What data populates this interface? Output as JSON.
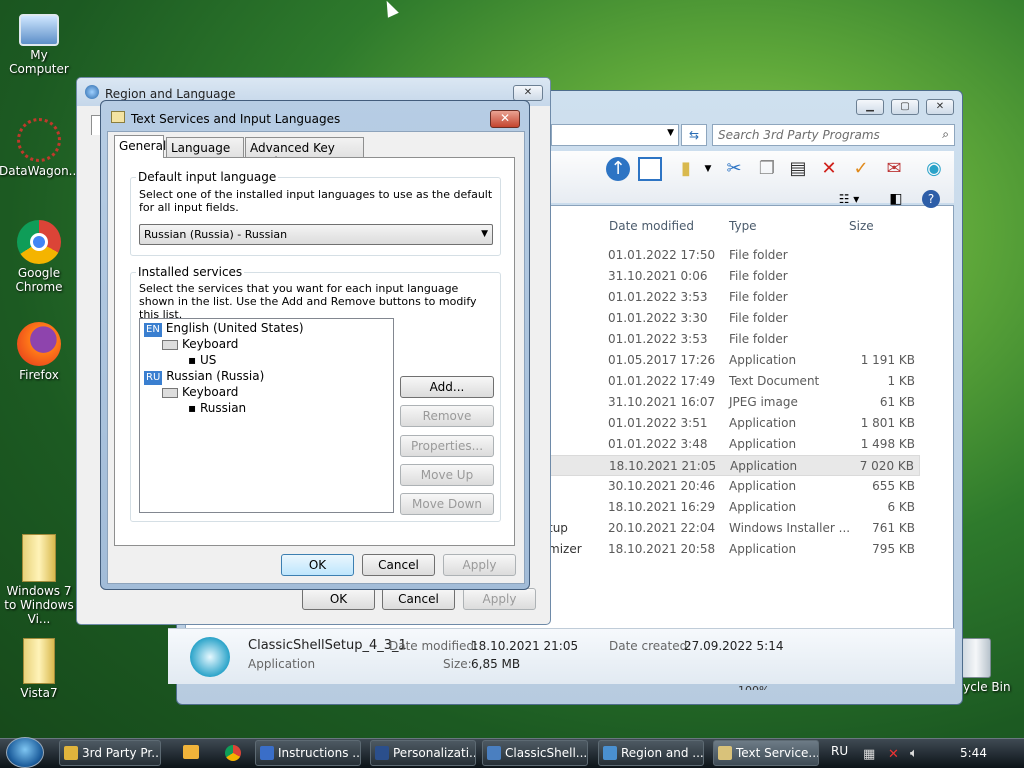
{
  "desktop": {
    "icons": [
      {
        "label": "My Computer"
      },
      {
        "label": "DataWagon..."
      },
      {
        "label": "Google Chrome"
      },
      {
        "label": "Firefox"
      },
      {
        "label": "Windows 7 to Windows Vi..."
      },
      {
        "label": "Vista7"
      },
      {
        "label": "Recycle Bin"
      }
    ]
  },
  "explorer": {
    "search_placeholder": "Search 3rd Party Programs",
    "columns": {
      "date": "Date modified",
      "type": "Type",
      "size": "Size"
    },
    "rows": [
      {
        "name": "",
        "date": "01.01.2022 17:50",
        "type": "File folder",
        "size": ""
      },
      {
        "name": "",
        "date": "31.10.2021 0:06",
        "type": "File folder",
        "size": ""
      },
      {
        "name": "",
        "date": "01.01.2022 3:53",
        "type": "File folder",
        "size": ""
      },
      {
        "name": "",
        "date": "01.01.2022 3:30",
        "type": "File folder",
        "size": ""
      },
      {
        "name": "",
        "date": "01.01.2022 3:53",
        "type": "File folder",
        "size": ""
      },
      {
        "name": "",
        "date": "01.05.2017 17:26",
        "type": "Application",
        "size": "1 191 KB"
      },
      {
        "name": "",
        "date": "01.01.2022 17:49",
        "type": "Text Document",
        "size": "1 KB"
      },
      {
        "name": "",
        "date": "31.10.2021 16:07",
        "type": "JPEG image",
        "size": "61 KB"
      },
      {
        "name": "",
        "date": "01.01.2022 3:51",
        "type": "Application",
        "size": "1 801 KB"
      },
      {
        "name": "",
        "date": "01.01.2022 3:48",
        "type": "Application",
        "size": "1 498 KB"
      },
      {
        "name": "",
        "date": "18.10.2021 21:05",
        "type": "Application",
        "size": "7 020 KB"
      },
      {
        "name": "",
        "date": "30.10.2021 20:46",
        "type": "Application",
        "size": "655 KB"
      },
      {
        "name": "",
        "date": "18.10.2021 16:29",
        "type": "Application",
        "size": "6 KB"
      },
      {
        "name": "tup",
        "date": "20.10.2021 22:04",
        "type": "Windows Installer ...",
        "size": "761 KB"
      },
      {
        "name": "mizer",
        "date": "18.10.2021 20:58",
        "type": "Application",
        "size": "795 KB"
      }
    ],
    "details": {
      "name": "ClassicShellSetup_4_3_1",
      "type": "Application",
      "date_modified_label": "Date modified:",
      "date_modified": "18.10.2021 21:05",
      "size_label": "Size:",
      "size": "6,85 MB",
      "date_created_label": "Date created:",
      "date_created": "27.09.2022 5:14"
    },
    "zoom": "100%"
  },
  "region_dialog": {
    "title": "Region and Language",
    "ok": "OK",
    "cancel": "Cancel",
    "apply": "Apply"
  },
  "ts_dialog": {
    "title": "Text Services and Input Languages",
    "tabs": [
      "General",
      "Language Bar",
      "Advanced Key Settings"
    ],
    "default_group": "Default input language",
    "default_desc": "Select one of the installed input languages to use as the default for all input fields.",
    "default_value": "Russian (Russia) - Russian",
    "installed_group": "Installed services",
    "installed_desc": "Select the services that you want for each input language shown in the list. Use the Add and Remove buttons to modify this list.",
    "tree": {
      "en_badge": "EN",
      "en_label": "English (United States)",
      "en_kb": "Keyboard",
      "en_layout": "US",
      "ru_badge": "RU",
      "ru_label": "Russian (Russia)",
      "ru_kb": "Keyboard",
      "ru_layout": "Russian"
    },
    "buttons": {
      "add": "Add...",
      "remove": "Remove",
      "properties": "Properties...",
      "move_up": "Move Up",
      "move_down": "Move Down"
    },
    "ok": "OK",
    "cancel": "Cancel",
    "apply": "Apply"
  },
  "taskbar": {
    "items": [
      {
        "label": "3rd Party Pr..."
      },
      {
        "label": "Instructions ..."
      },
      {
        "label": "Personalizati..."
      },
      {
        "label": "ClassicShell..."
      },
      {
        "label": "Region and ..."
      },
      {
        "label": "Text Service..."
      }
    ],
    "lang": "RU",
    "clock": "5:44"
  }
}
